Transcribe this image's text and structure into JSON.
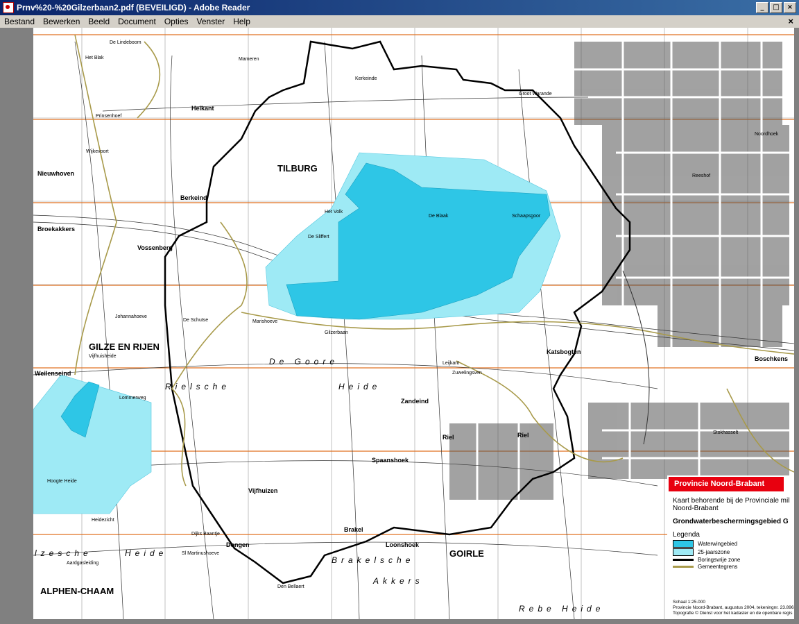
{
  "window": {
    "title": "Prnv%20-%20Gilzerbaan2.pdf (BEVEILIGD) - Adobe Reader",
    "min_label": "_",
    "max_label": "□",
    "close_label": "×"
  },
  "menu": {
    "items": [
      "Bestand",
      "Bewerken",
      "Beeld",
      "Document",
      "Opties",
      "Venster",
      "Help"
    ],
    "close_doc": "×"
  },
  "colors": {
    "waterwingebied": "#2ec6e6",
    "zone25": "#9eeaf5",
    "boringsvrij": "#000000",
    "gemeentegrens": "#a89a4a",
    "gridline": "#e07020",
    "header_red": "#e8000f"
  },
  "map": {
    "places_big": [
      "TILBURG",
      "GILZE EN RIJEN",
      "ALPHEN-CHAAM",
      "GOIRLE"
    ],
    "places_mid": [
      "Riel",
      "Riel",
      "Zandeind",
      "Berkeind",
      "Vossenberg",
      "Heikant",
      "Boschkens",
      "Katsbogten",
      "Broekakkers",
      "Nieuwhoven",
      "Weilenseind",
      "Spaanshoek",
      "Vijfhuizen",
      "Dongen",
      "Loonshoek",
      "Brakel"
    ],
    "places_small": [
      "De Lindeboom",
      "Het Blak",
      "Prinsenhoef",
      "Wijkevoort",
      "Mameren",
      "De Sliffert",
      "Kerkeinde",
      "De Blaak",
      "Schaapsgoor",
      "Het Volk",
      "De Schutse",
      "Marishoeve",
      "Johannahoeve",
      "Vijfhuisheide",
      "Leijkant",
      "Hoogte Heide",
      "Heidezicht",
      "Sl Martinushoeve",
      "Aardgasleiding",
      "Den Bellaert",
      "Dijks Baantje",
      "Lommerweg",
      "Gilzerbaan",
      "Zuwelingsven",
      "Groot Warande",
      "Noordhoek",
      "Reeshof",
      "Stokhasselt"
    ],
    "heide_labels": [
      "Rielsche",
      "Heide",
      "De Goore",
      "lzesche",
      "Heide",
      "Brakelsche",
      "Akkers",
      "Rebe Heide"
    ]
  },
  "legend": {
    "header": "Provincie Noord-Brabant",
    "subtitle_line1": "Kaart behorende bij de Provinciale mil",
    "subtitle_line2": "Noord-Brabant",
    "title": "Grondwaterbeschermingsgebied G",
    "legenda": "Legenda",
    "items": [
      {
        "label": "Waterwingebied",
        "kind": "fill",
        "color": "#2ec6e6"
      },
      {
        "label": "25-jaarszone",
        "kind": "fill",
        "color": "#9eeaf5"
      },
      {
        "label": "Boringsvrije zone",
        "kind": "line",
        "color": "#000000"
      },
      {
        "label": "Gemeentegrens",
        "kind": "line",
        "color": "#a89a4a"
      }
    ],
    "foot_line1": "Schaal 1:25.000",
    "foot_line2": "Provincie Noord-Brabant, augustus 2004, tekeningnr. 23.896",
    "foot_line3": "Topografie © Dienst voor het kadaster en de openbare regis"
  }
}
